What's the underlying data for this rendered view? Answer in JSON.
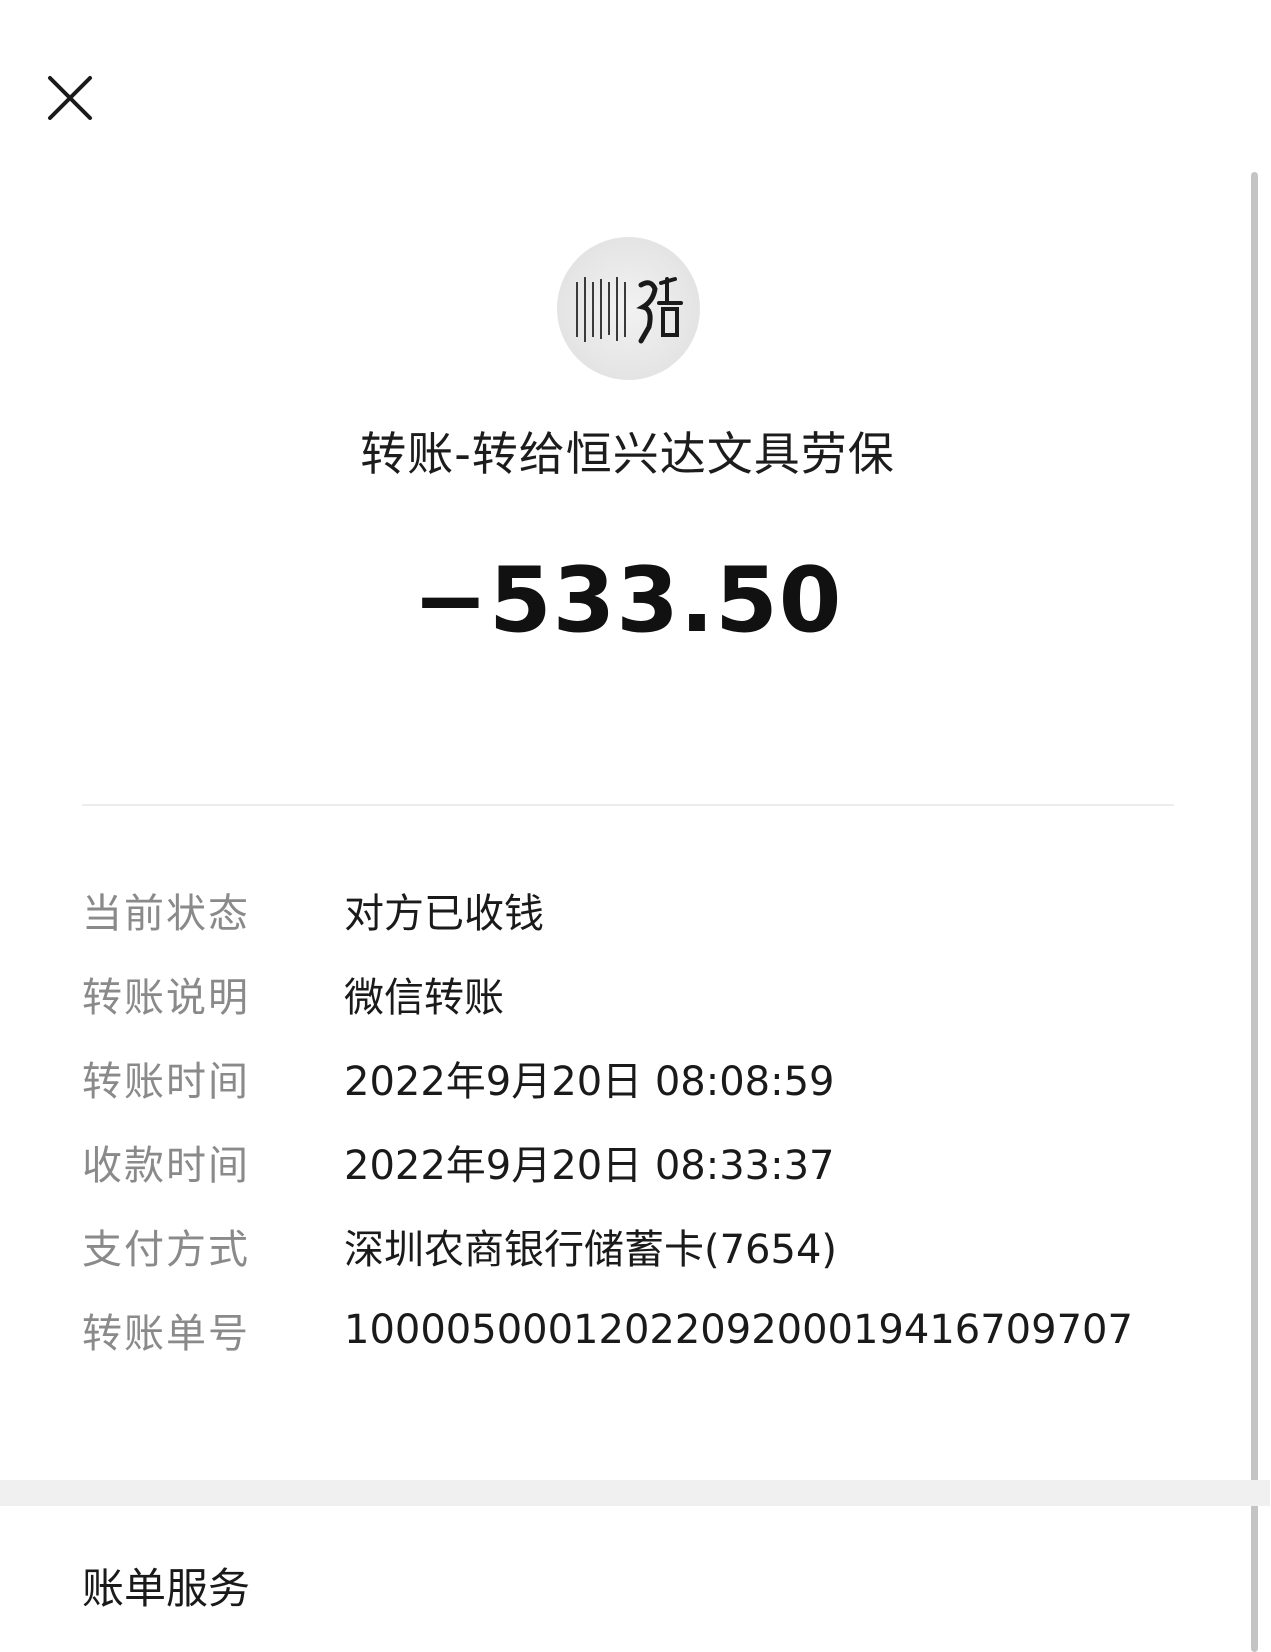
{
  "header": {
    "close_icon": "close-icon"
  },
  "payee": {
    "avatar_icon": "merchant-avatar-icon",
    "title": "转账-转给恒兴达文具劳保",
    "amount": "−533.50"
  },
  "details": [
    {
      "label": "当前状态",
      "value": "对方已收钱"
    },
    {
      "label": "转账说明",
      "value": "微信转账"
    },
    {
      "label": "转账时间",
      "value": "2022年9月20日 08:08:59"
    },
    {
      "label": "收款时间",
      "value": "2022年9月20日 08:33:37"
    },
    {
      "label": "支付方式",
      "value": "深圳农商银行储蓄卡(7654)"
    },
    {
      "label": "转账单号",
      "value": "1000050001202209200019416709707"
    }
  ],
  "footer": {
    "bill_service": "账单服务"
  },
  "colors": {
    "background": "#ffffff",
    "label_gray": "#8a8a8a",
    "text_dark": "#1a1a1a",
    "section_gap": "#f0f0f0"
  }
}
